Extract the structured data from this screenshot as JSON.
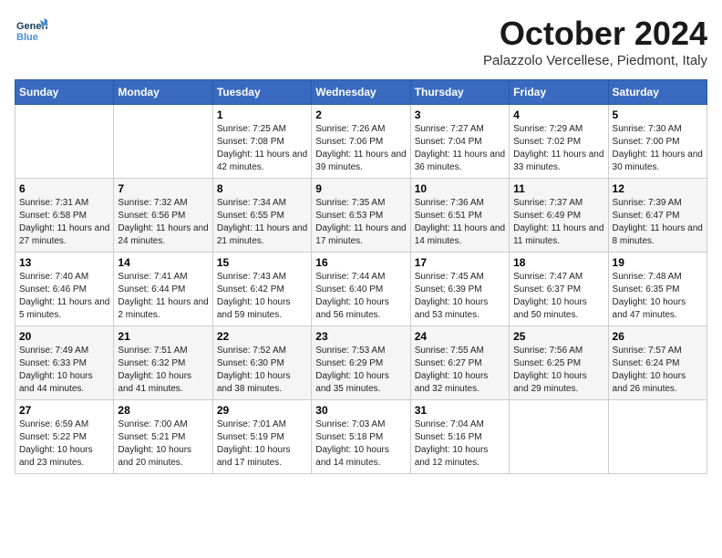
{
  "header": {
    "logo": {
      "general": "General",
      "blue": "Blue"
    },
    "title": "October 2024",
    "location": "Palazzolo Vercellese, Piedmont, Italy"
  },
  "calendar": {
    "days_of_week": [
      "Sunday",
      "Monday",
      "Tuesday",
      "Wednesday",
      "Thursday",
      "Friday",
      "Saturday"
    ],
    "weeks": [
      [
        {
          "day": "",
          "info": ""
        },
        {
          "day": "",
          "info": ""
        },
        {
          "day": "1",
          "info": "Sunrise: 7:25 AM\nSunset: 7:08 PM\nDaylight: 11 hours and 42 minutes."
        },
        {
          "day": "2",
          "info": "Sunrise: 7:26 AM\nSunset: 7:06 PM\nDaylight: 11 hours and 39 minutes."
        },
        {
          "day": "3",
          "info": "Sunrise: 7:27 AM\nSunset: 7:04 PM\nDaylight: 11 hours and 36 minutes."
        },
        {
          "day": "4",
          "info": "Sunrise: 7:29 AM\nSunset: 7:02 PM\nDaylight: 11 hours and 33 minutes."
        },
        {
          "day": "5",
          "info": "Sunrise: 7:30 AM\nSunset: 7:00 PM\nDaylight: 11 hours and 30 minutes."
        }
      ],
      [
        {
          "day": "6",
          "info": "Sunrise: 7:31 AM\nSunset: 6:58 PM\nDaylight: 11 hours and 27 minutes."
        },
        {
          "day": "7",
          "info": "Sunrise: 7:32 AM\nSunset: 6:56 PM\nDaylight: 11 hours and 24 minutes."
        },
        {
          "day": "8",
          "info": "Sunrise: 7:34 AM\nSunset: 6:55 PM\nDaylight: 11 hours and 21 minutes."
        },
        {
          "day": "9",
          "info": "Sunrise: 7:35 AM\nSunset: 6:53 PM\nDaylight: 11 hours and 17 minutes."
        },
        {
          "day": "10",
          "info": "Sunrise: 7:36 AM\nSunset: 6:51 PM\nDaylight: 11 hours and 14 minutes."
        },
        {
          "day": "11",
          "info": "Sunrise: 7:37 AM\nSunset: 6:49 PM\nDaylight: 11 hours and 11 minutes."
        },
        {
          "day": "12",
          "info": "Sunrise: 7:39 AM\nSunset: 6:47 PM\nDaylight: 11 hours and 8 minutes."
        }
      ],
      [
        {
          "day": "13",
          "info": "Sunrise: 7:40 AM\nSunset: 6:46 PM\nDaylight: 11 hours and 5 minutes."
        },
        {
          "day": "14",
          "info": "Sunrise: 7:41 AM\nSunset: 6:44 PM\nDaylight: 11 hours and 2 minutes."
        },
        {
          "day": "15",
          "info": "Sunrise: 7:43 AM\nSunset: 6:42 PM\nDaylight: 10 hours and 59 minutes."
        },
        {
          "day": "16",
          "info": "Sunrise: 7:44 AM\nSunset: 6:40 PM\nDaylight: 10 hours and 56 minutes."
        },
        {
          "day": "17",
          "info": "Sunrise: 7:45 AM\nSunset: 6:39 PM\nDaylight: 10 hours and 53 minutes."
        },
        {
          "day": "18",
          "info": "Sunrise: 7:47 AM\nSunset: 6:37 PM\nDaylight: 10 hours and 50 minutes."
        },
        {
          "day": "19",
          "info": "Sunrise: 7:48 AM\nSunset: 6:35 PM\nDaylight: 10 hours and 47 minutes."
        }
      ],
      [
        {
          "day": "20",
          "info": "Sunrise: 7:49 AM\nSunset: 6:33 PM\nDaylight: 10 hours and 44 minutes."
        },
        {
          "day": "21",
          "info": "Sunrise: 7:51 AM\nSunset: 6:32 PM\nDaylight: 10 hours and 41 minutes."
        },
        {
          "day": "22",
          "info": "Sunrise: 7:52 AM\nSunset: 6:30 PM\nDaylight: 10 hours and 38 minutes."
        },
        {
          "day": "23",
          "info": "Sunrise: 7:53 AM\nSunset: 6:29 PM\nDaylight: 10 hours and 35 minutes."
        },
        {
          "day": "24",
          "info": "Sunrise: 7:55 AM\nSunset: 6:27 PM\nDaylight: 10 hours and 32 minutes."
        },
        {
          "day": "25",
          "info": "Sunrise: 7:56 AM\nSunset: 6:25 PM\nDaylight: 10 hours and 29 minutes."
        },
        {
          "day": "26",
          "info": "Sunrise: 7:57 AM\nSunset: 6:24 PM\nDaylight: 10 hours and 26 minutes."
        }
      ],
      [
        {
          "day": "27",
          "info": "Sunrise: 6:59 AM\nSunset: 5:22 PM\nDaylight: 10 hours and 23 minutes."
        },
        {
          "day": "28",
          "info": "Sunrise: 7:00 AM\nSunset: 5:21 PM\nDaylight: 10 hours and 20 minutes."
        },
        {
          "day": "29",
          "info": "Sunrise: 7:01 AM\nSunset: 5:19 PM\nDaylight: 10 hours and 17 minutes."
        },
        {
          "day": "30",
          "info": "Sunrise: 7:03 AM\nSunset: 5:18 PM\nDaylight: 10 hours and 14 minutes."
        },
        {
          "day": "31",
          "info": "Sunrise: 7:04 AM\nSunset: 5:16 PM\nDaylight: 10 hours and 12 minutes."
        },
        {
          "day": "",
          "info": ""
        },
        {
          "day": "",
          "info": ""
        }
      ]
    ]
  }
}
